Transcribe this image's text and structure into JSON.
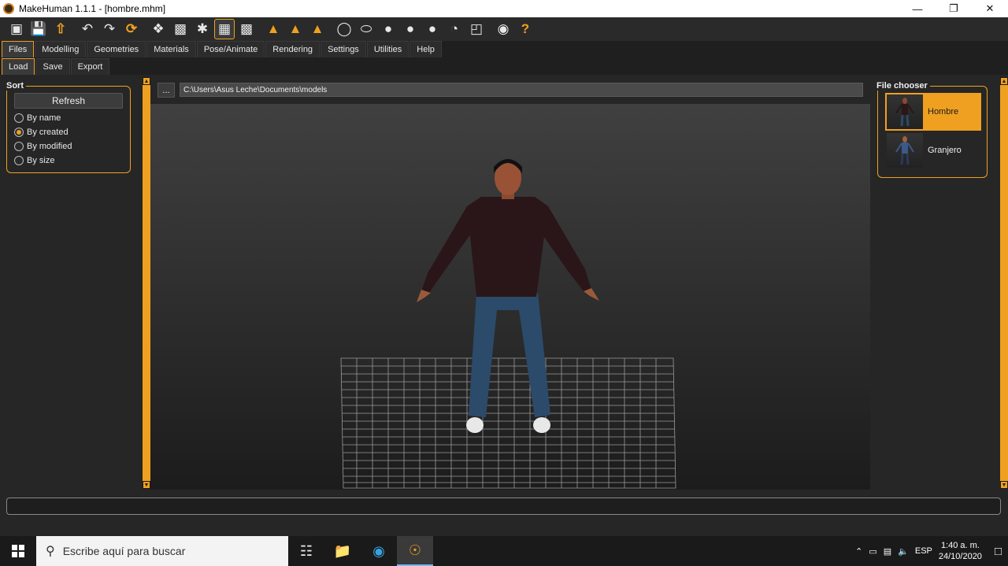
{
  "window": {
    "title": "MakeHuman 1.1.1 - [hombre.mhm]"
  },
  "toolbar": {
    "icons": [
      "cube-icon",
      "save-icon",
      "export-icon",
      "undo-icon",
      "redo-icon",
      "reset-icon",
      "wireframe-icon",
      "mesh-icon",
      "pose-icon",
      "grid-icon",
      "checker-icon",
      "front-view-icon",
      "side-view-icon",
      "back-view-icon",
      "face-icon",
      "head-icon",
      "top-icon",
      "left-icon",
      "bottom-icon",
      "smooth-icon",
      "subdivide-icon",
      "screenshot-icon",
      "help-icon"
    ]
  },
  "main_tabs": [
    "Files",
    "Modelling",
    "Geometries",
    "Materials",
    "Pose/Animate",
    "Rendering",
    "Settings",
    "Utilities",
    "Help"
  ],
  "sub_tabs": [
    "Load",
    "Save",
    "Export"
  ],
  "sort": {
    "title": "Sort",
    "refresh_label": "Refresh",
    "options": [
      "By name",
      "By created",
      "By modified",
      "By size"
    ],
    "selected": "By created"
  },
  "path": {
    "button": "...",
    "value": "C:\\Users\\Asus Leche\\Documents\\models"
  },
  "file_chooser": {
    "title": "File chooser",
    "files": [
      "Hombre",
      "Granjero"
    ],
    "selected": "Hombre"
  },
  "taskbar": {
    "search_placeholder": "Escribe aquí para buscar",
    "language": "ESP",
    "time": "1:40 a. m.",
    "date": "24/10/2020"
  },
  "colors": {
    "accent": "#f0a020",
    "background": "#262626"
  }
}
